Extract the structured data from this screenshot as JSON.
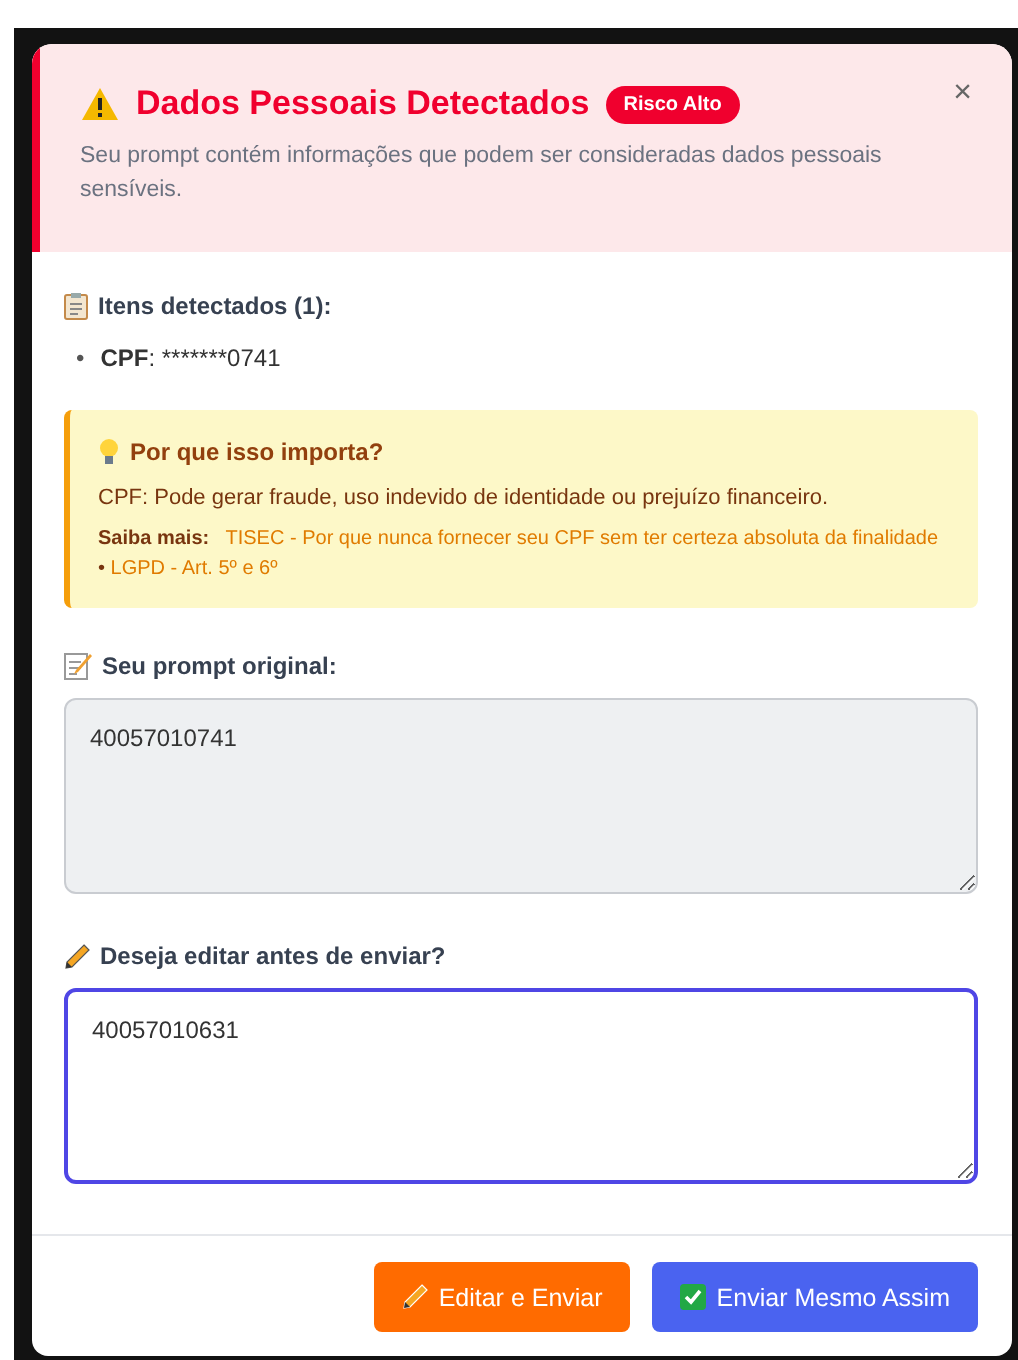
{
  "dialog": {
    "title": "Dados Pessoais Detectados",
    "risk_badge": "Risco Alto",
    "subtitle": "Seu prompt contém informações que podem ser consideradas dados pessoais sensíveis.",
    "close": "×"
  },
  "detected": {
    "heading": "Itens detectados (1):",
    "items": [
      {
        "bullet": "•",
        "label": "CPF",
        "value": ": *******0741"
      }
    ]
  },
  "why": {
    "heading": "Por que isso importa?",
    "text": "CPF: Pode gerar fraude, uso indevido de identidade ou prejuízo financeiro.",
    "more_label": "Saiba mais:",
    "links": [
      "TISEC - Por que nunca fornecer seu CPF sem ter certeza absoluta da finalidade",
      "LGPD - Art. 5º e 6º"
    ],
    "separator": "•"
  },
  "original": {
    "label": "Seu prompt original:",
    "value": "40057010741"
  },
  "edit": {
    "label": "Deseja editar antes de enviar?",
    "value": "40057010631"
  },
  "buttons": [
    {
      "kind": "edit",
      "label": "Editar e Enviar"
    },
    {
      "kind": "send",
      "label": "Enviar Mesmo Assim"
    }
  ]
}
